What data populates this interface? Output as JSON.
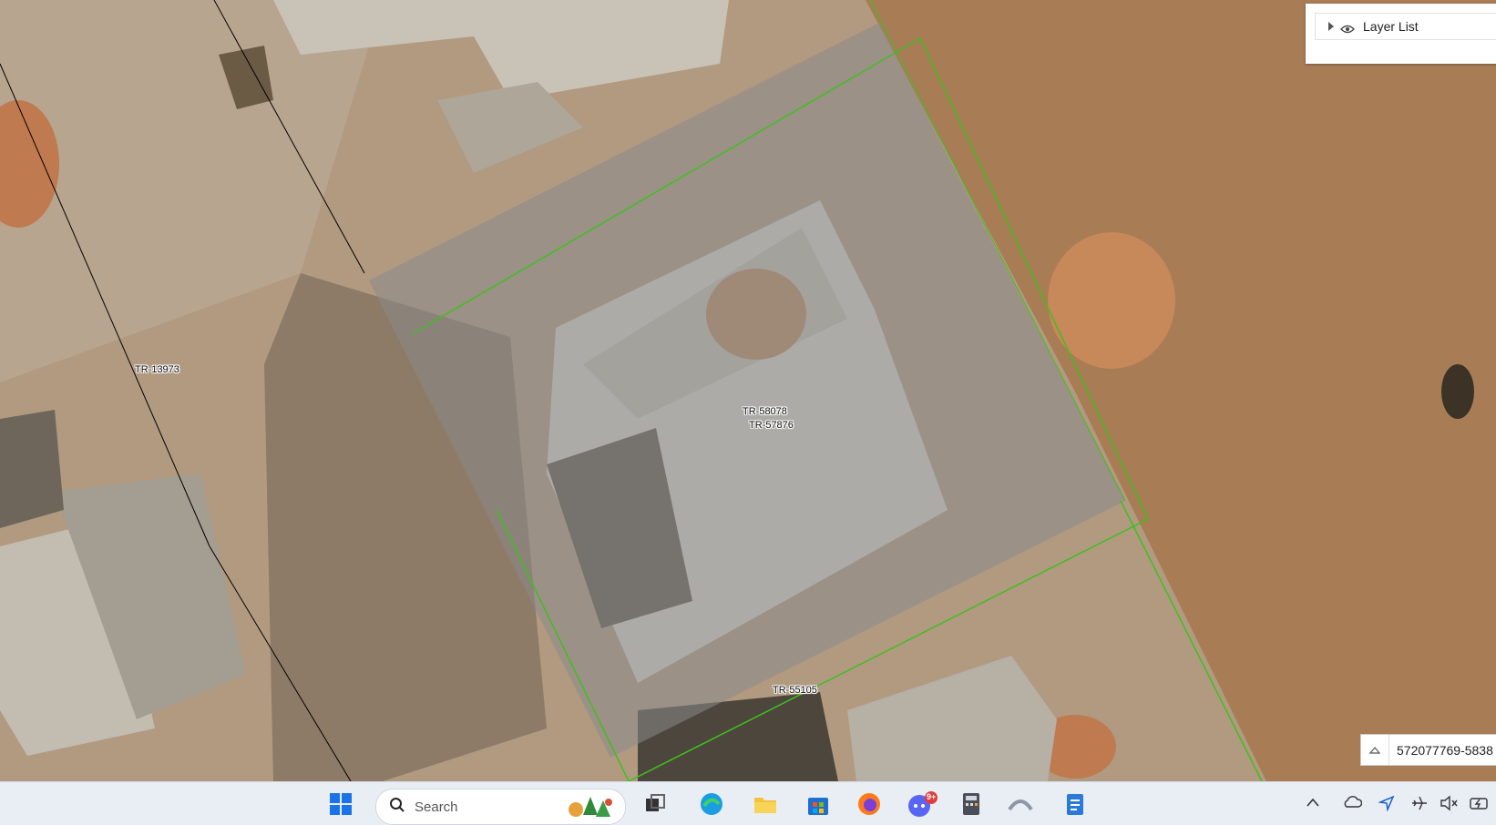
{
  "map": {
    "labels": {
      "tr_13973": "TR-13973",
      "tr_58078": "TR-58078",
      "tr_57876": "TR-57876",
      "tr_55105": "TR-55105"
    }
  },
  "layer_list": {
    "title": "Layer List"
  },
  "coordinates": {
    "value": "572077769-5838"
  },
  "taskbar": {
    "search_placeholder": "Search",
    "chat_badge": "9+"
  },
  "colors": {
    "parcel_outline": "#3fbf1f",
    "taskbar_bg": "#e9eef5"
  }
}
